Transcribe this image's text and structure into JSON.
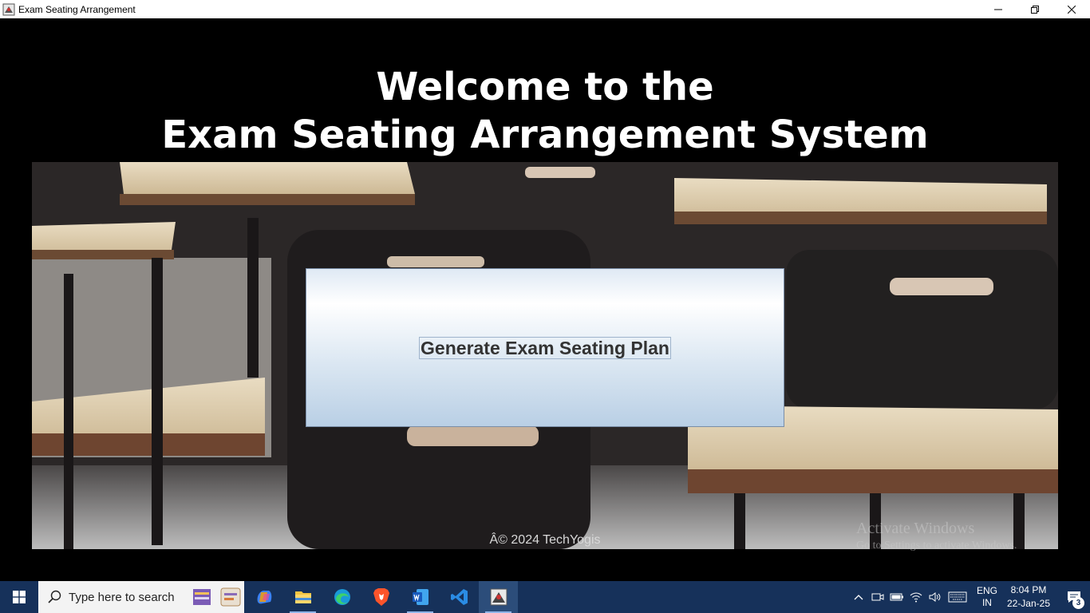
{
  "window": {
    "title": "Exam Seating Arrangement",
    "icon": "app-icon",
    "controls": [
      "minimize-icon",
      "restore-icon",
      "close-icon"
    ]
  },
  "main": {
    "heading_line1": "Welcome to the",
    "heading_line2": "Exam Seating Arrangement System",
    "background_image": "classroom-desks-photo",
    "generate_button_label": "Generate Exam Seating Plan",
    "copyright": "Â© 2024 TechYogis"
  },
  "watermark": {
    "line1": "Activate Windows",
    "line2": "Go to Settings to activate Windows."
  },
  "taskbar": {
    "search_placeholder": "Type here to search",
    "apps": [
      "copilot-icon",
      "file-explorer-icon",
      "edge-icon",
      "brave-icon",
      "word-icon",
      "vscode-icon",
      "java-app-icon"
    ],
    "tray": {
      "lang_line1": "ENG",
      "lang_line2": "IN",
      "time": "8:04 PM",
      "date": "22-Jan-25",
      "notification_count": "3"
    }
  },
  "colors": {
    "background": "#000000",
    "taskbar": "#16315a",
    "button_gradient_top": "#ffffff",
    "button_gradient_bottom": "#b9cfe5"
  }
}
